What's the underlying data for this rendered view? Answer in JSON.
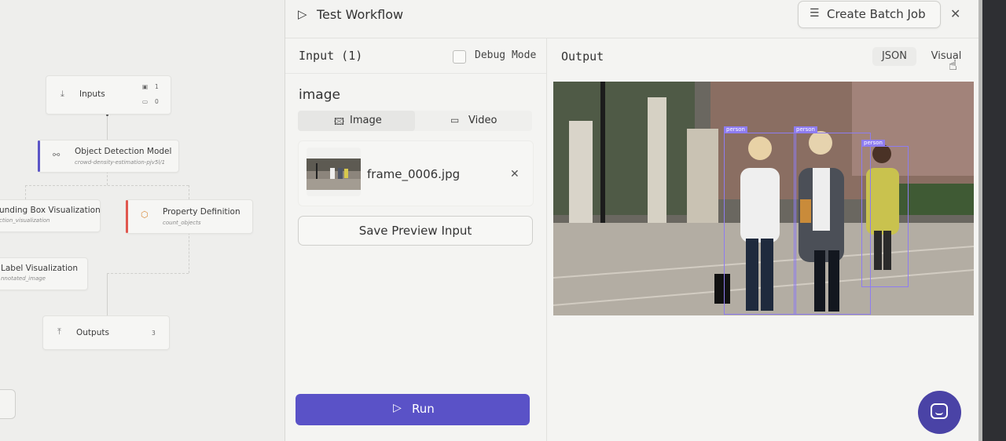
{
  "canvas": {
    "nodes": {
      "inputs": {
        "label": "Inputs",
        "count_a": "1",
        "count_b": "0"
      },
      "object_detection": {
        "label": "Object Detection Model",
        "sub": "crowd-density-estimation-pjv5l/1"
      },
      "bbox_vis": {
        "label": "unding Box Visualization",
        "sub": "ction_visualization"
      },
      "property_def": {
        "label": "Property Definition",
        "sub": "count_objects"
      },
      "label_vis": {
        "label": "Label Visualization",
        "sub": "nnotated_image"
      },
      "outputs": {
        "label": "Outputs",
        "count": "3"
      }
    },
    "accent_colors": {
      "object_detection": "#5b55c7",
      "property_def": "#e0574f"
    }
  },
  "panel": {
    "title": "Test Workflow",
    "create_batch_label": "Create Batch Job",
    "input": {
      "title": "Input (1)",
      "debug_label": "Debug Mode",
      "field_label": "image",
      "tabs": [
        {
          "label": "Image"
        },
        {
          "label": "Video"
        }
      ],
      "file_name": "frame_0006.jpg",
      "save_label": "Save Preview Input",
      "run_label": "Run"
    },
    "output": {
      "title": "Output",
      "view_json": "JSON",
      "view_visual": "Visual",
      "detections": [
        {
          "label": "person"
        },
        {
          "label": "person"
        },
        {
          "label": "person"
        }
      ]
    }
  },
  "colors": {
    "primary": "#5a52c7",
    "bbox": "#8e7cf0",
    "chat": "#4a43a6"
  }
}
